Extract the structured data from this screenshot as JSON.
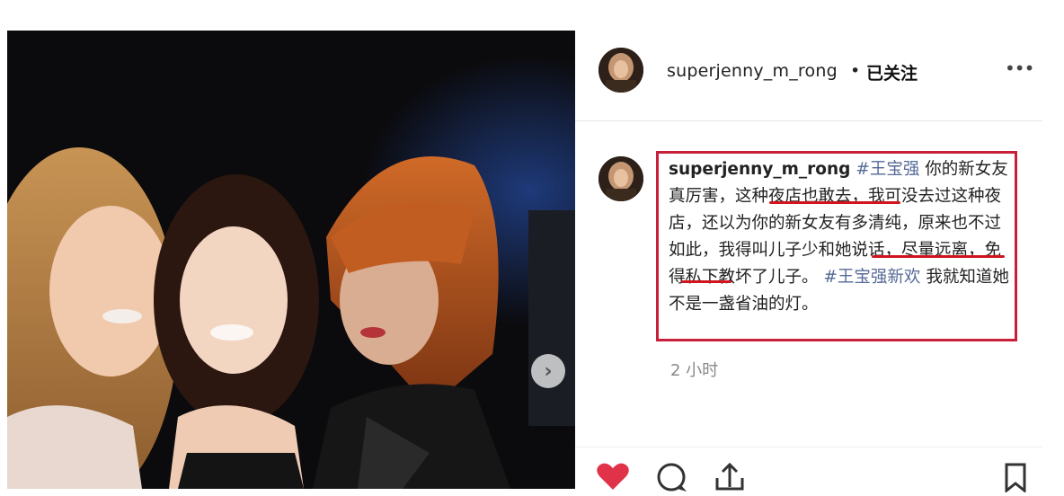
{
  "post": {
    "username": "superjenny_m_rong",
    "separator": "•",
    "follow_status": "已关注",
    "more_icon": "more-options-icon",
    "next_icon": "chevron-right-icon"
  },
  "comment": {
    "username": "superjenny_m_rong",
    "tag1": "#王宝强",
    "text1": "你的新女友真厉害，这种夜店也敢去，我可没去过这种夜店，还以为你的新女友有多清纯，原来也不过如此，我得叫儿子少和她说话，尽量远离，免得私下教坏了儿子。",
    "tag2": "#王宝强新欢",
    "text2": "我就知道她不是一盏省油的灯。",
    "timestamp": "2 小时",
    "highlight_color": "#c8203a"
  },
  "actions": {
    "like_icon": "heart-icon",
    "comment_icon": "comment-icon",
    "share_icon": "share-icon",
    "save_icon": "bookmark-icon",
    "like_color": "#e0334a"
  }
}
